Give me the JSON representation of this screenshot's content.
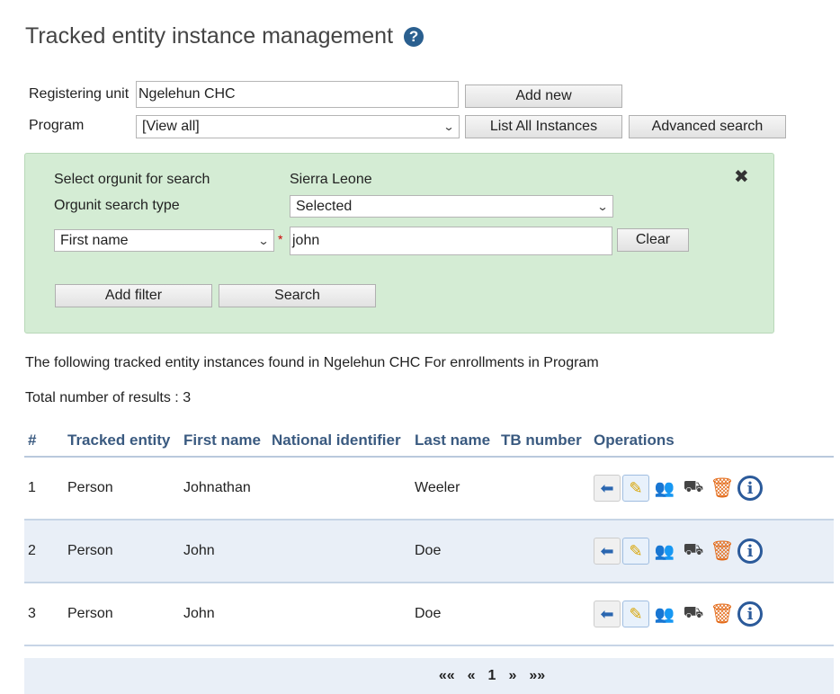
{
  "header": {
    "title": "Tracked entity instance management",
    "help_symbol": "?"
  },
  "form": {
    "registering_unit_label": "Registering unit",
    "registering_unit_value": "Ngelehun CHC",
    "program_label": "Program",
    "program_value": "[View all]",
    "add_new_label": "Add new",
    "list_all_label": "List All Instances",
    "advanced_search_label": "Advanced search"
  },
  "search_panel": {
    "orgunit_label": "Select orgunit for search",
    "orgunit_value": "Sierra Leone",
    "search_type_label": "Orgunit search type",
    "search_type_value": "Selected",
    "attribute_value": "First name",
    "required_mark": "*",
    "query_value": "john",
    "clear_label": "Clear",
    "add_filter_label": "Add filter",
    "search_label": "Search",
    "close_symbol": "✖"
  },
  "results": {
    "summary": "The following tracked entity instances found in Ngelehun CHC For enrollments in Program",
    "total": "Total number of results : 3",
    "columns": [
      "#",
      "Tracked entity",
      "First name",
      "National identifier",
      "Last name",
      "TB number",
      "Operations"
    ],
    "rows": [
      {
        "num": "1",
        "entity": "Person",
        "first": "Johnathan",
        "national_id": "",
        "last": "Weeler",
        "tb": ""
      },
      {
        "num": "2",
        "entity": "Person",
        "first": "John",
        "national_id": "",
        "last": "Doe",
        "tb": ""
      },
      {
        "num": "3",
        "entity": "Person",
        "first": "John",
        "national_id": "",
        "last": "Doe",
        "tb": ""
      }
    ],
    "operation_icons": [
      "go-back-icon",
      "edit-icon",
      "relationship-icon",
      "move-icon",
      "delete-icon",
      "info-icon"
    ]
  },
  "pager": {
    "first": "««",
    "prev": "«",
    "current": "1",
    "next": "»",
    "last": "»»"
  },
  "colors": {
    "panel_bg": "#d4ecd4",
    "header_text": "#3a5a80",
    "alt_row": "#e9eff7",
    "help_icon": "#2a5f8f"
  }
}
